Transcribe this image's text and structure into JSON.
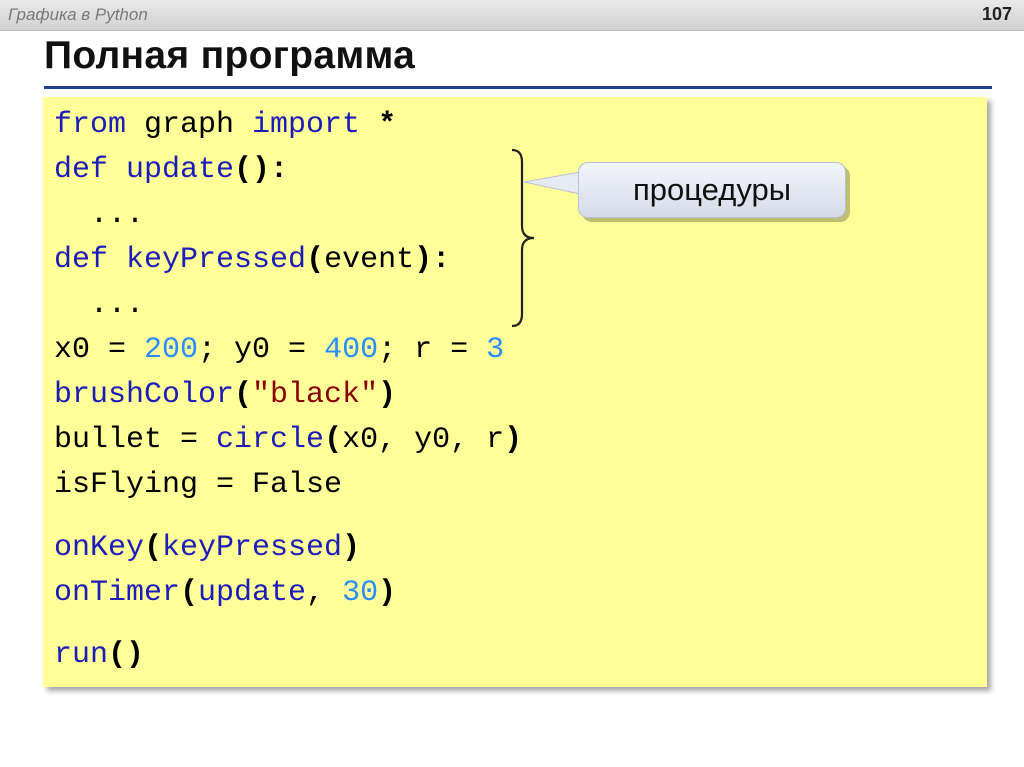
{
  "header": {
    "course": "Графика в Python",
    "slide_number": "107"
  },
  "title": "Полная программа",
  "code": {
    "l1": {
      "a": "from",
      "b": " graph ",
      "c": "import",
      "d": " *"
    },
    "l2": {
      "a": "def",
      "b": " update",
      "c": "():"
    },
    "l3": "  ...",
    "l4": {
      "a": "def",
      "b": " keyPressed",
      "c": "(",
      "d": "event",
      "e": "):"
    },
    "l5": "  ...",
    "l6": {
      "a": "x0 = ",
      "b": "200",
      "c": "; y0 = ",
      "d": "400",
      "e": "; r = ",
      "f": "3"
    },
    "l7": {
      "a": "brushColor",
      "b": "(",
      "c": "\"black\"",
      "d": ")"
    },
    "l8": {
      "a": "bullet = ",
      "b": "circle",
      "c": "(",
      "d": "x0, y0, r",
      "e": ")"
    },
    "l9": "isFlying = False",
    "l10": {
      "a": "onKey",
      "b": "(",
      "c": "keyPressed",
      "d": ")"
    },
    "l11": {
      "a": "onTimer",
      "b": "(",
      "c": "update",
      "d": ", ",
      "e": "30",
      "f": ")"
    },
    "l12": {
      "a": "run",
      "b": "()"
    }
  },
  "callout": {
    "text": "процедуры"
  }
}
